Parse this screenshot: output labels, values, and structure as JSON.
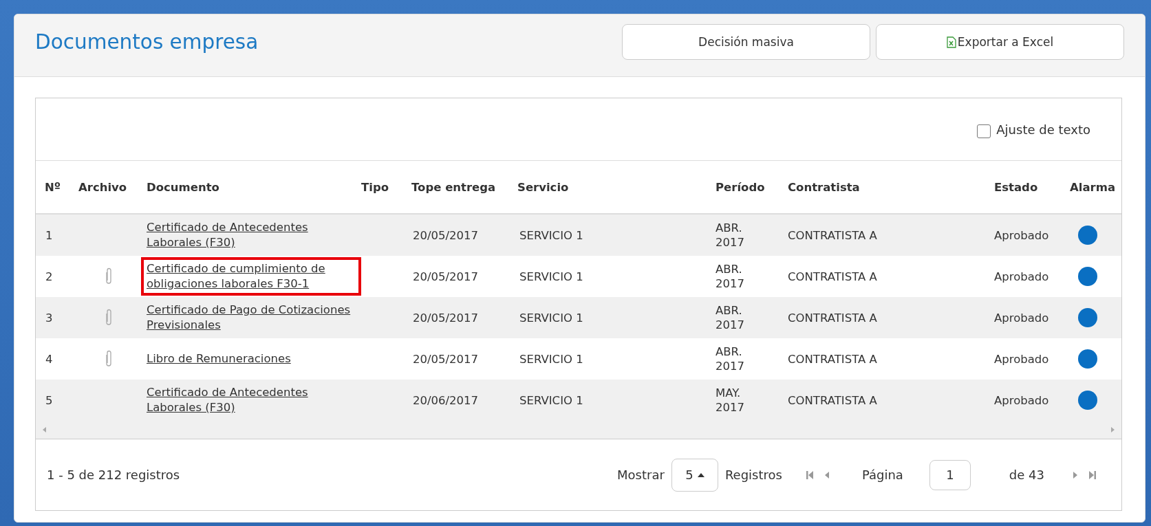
{
  "header": {
    "title": "Documentos empresa",
    "buttons": [
      {
        "label": "Decisión masiva",
        "kind": "plain"
      },
      {
        "label": "Exportar a Excel",
        "kind": "excel"
      }
    ]
  },
  "toolbar": {
    "wrap_text": {
      "label": "Ajuste de texto",
      "checked": false
    }
  },
  "table": {
    "columns": [
      "Nº",
      "Archivo",
      "Documento",
      "Tipo",
      "Tope entrega",
      "Servicio",
      "Período",
      "Contratista",
      "Estado",
      "Alarma"
    ],
    "rows": [
      {
        "no": "1",
        "attachment": false,
        "document": "Certificado de Antecedentes Laborales (F30)",
        "highlighted": false,
        "deadline": "20/05/2017",
        "service": "SERVICIO 1",
        "period": "ABR. 2017",
        "contractor": "CONTRATISTA A",
        "status": "Aprobado",
        "color": "#0a6fc2"
      },
      {
        "no": "2",
        "attachment": true,
        "document": "Certificado de cumplimiento de obligaciones laborales F30-1",
        "highlighted": true,
        "deadline": "20/05/2017",
        "service": "SERVICIO 1",
        "period": "ABR. 2017",
        "contractor": "CONTRATISTA A",
        "status": "Aprobado",
        "color": "#0a6fc2"
      },
      {
        "no": "3",
        "attachment": true,
        "document": "Certificado de Pago de Cotizaciones Previsionales",
        "highlighted": false,
        "deadline": "20/05/2017",
        "service": "SERVICIO 1",
        "period": "ABR. 2017",
        "contractor": "CONTRATISTA A",
        "status": "Aprobado",
        "color": "#0a6fc2"
      },
      {
        "no": "4",
        "attachment": true,
        "document": "Libro de Remuneraciones",
        "highlighted": false,
        "deadline": "20/05/2017",
        "service": "SERVICIO 1",
        "period": "ABR. 2017",
        "contractor": "CONTRATISTA A",
        "status": "Aprobado",
        "color": "#0a6fc2"
      },
      {
        "no": "5",
        "attachment": false,
        "document": "Certificado de Antecedentes Laborales (F30)",
        "highlighted": false,
        "deadline": "20/06/2017",
        "service": "SERVICIO 1",
        "period": "MAY. 2017",
        "contractor": "CONTRATISTA A",
        "status": "Aprobado",
        "color": "#0a6fc2"
      }
    ]
  },
  "pager": {
    "summary": "1 - 5 de 212 registros",
    "show_label": "Mostrar",
    "page_size": "5",
    "records_label": "Registros",
    "page_label": "Página",
    "page": "1",
    "of_pages": "de 43"
  }
}
